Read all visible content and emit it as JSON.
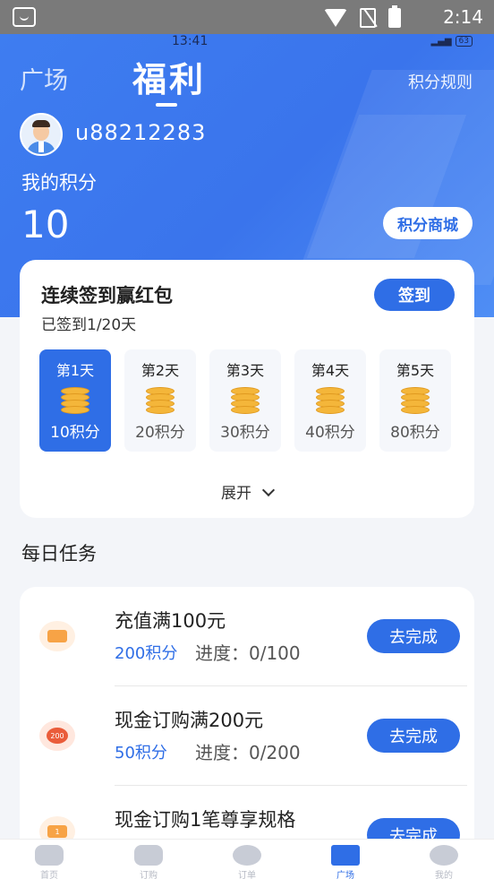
{
  "status_bar": {
    "time": "2:14"
  },
  "inner_status": {
    "time": "13:41",
    "battery": "63"
  },
  "header": {
    "tab_plaza": "广场",
    "tab_welfare": "福利",
    "rules": "积分规则",
    "username": "u88212283",
    "points_label": "我的积分",
    "points_value": "10",
    "mall_button": "积分商城"
  },
  "signin": {
    "title": "连续签到赢红包",
    "subtitle": "已签到1/20天",
    "button": "签到",
    "days": [
      {
        "label": "第1天",
        "points": "10积分",
        "active": true
      },
      {
        "label": "第2天",
        "points": "20积分",
        "active": false
      },
      {
        "label": "第3天",
        "points": "30积分",
        "active": false
      },
      {
        "label": "第4天",
        "points": "40积分",
        "active": false
      },
      {
        "label": "第5天",
        "points": "80积分",
        "active": false
      }
    ],
    "expand": "展开"
  },
  "daily_tasks": {
    "title": "每日任务",
    "items": [
      {
        "name": "充值满100元",
        "points": "200积分",
        "progress": "进度：0/100",
        "button": "去完成",
        "icon": "wallet-icon"
      },
      {
        "name": "现金订购满200元",
        "points": "50积分",
        "progress": "进度：0/200",
        "button": "去完成",
        "icon": "coupon-200-icon",
        "icon_text": "200"
      },
      {
        "name": "现金订购1笔尊享规格",
        "points": "",
        "progress": "",
        "button": "去完成",
        "icon": "badge-icon",
        "icon_text": "1"
      }
    ]
  },
  "bottom_nav": {
    "items": [
      {
        "label": "首页",
        "icon": "home-icon"
      },
      {
        "label": "订购",
        "icon": "clipboard-icon"
      },
      {
        "label": "订单",
        "icon": "order-icon"
      },
      {
        "label": "广场",
        "icon": "chart-icon",
        "active": true
      },
      {
        "label": "我的",
        "icon": "profile-icon"
      }
    ]
  },
  "colors": {
    "primary": "#2f6ee6",
    "header_bg": "#3e7df0",
    "coin": "#f4b63a"
  }
}
